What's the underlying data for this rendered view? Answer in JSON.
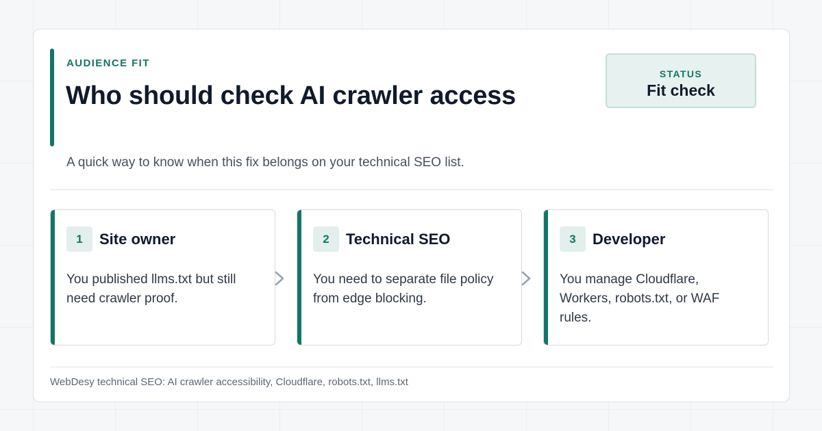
{
  "header": {
    "eyebrow": "AUDIENCE FIT",
    "title": "Who should check AI crawler access",
    "subtitle": "A quick way to know when this fix belongs on your technical SEO list."
  },
  "status": {
    "label": "STATUS",
    "value": "Fit check"
  },
  "steps": [
    {
      "number": "1",
      "title": "Site owner",
      "description": "You published llms.txt but still need crawler proof."
    },
    {
      "number": "2",
      "title": "Technical SEO",
      "description": "You need to separate file policy from edge blocking."
    },
    {
      "number": "3",
      "title": "Developer",
      "description": "You manage Cloudflare, Workers, robots.txt, or WAF rules."
    }
  ],
  "footer": {
    "text": "WebDesy technical SEO: AI crawler accessibility, Cloudflare, robots.txt, llms.txt"
  },
  "colors": {
    "accent": "#137565",
    "title_text": "#111a2b",
    "status_background": "#e7f1ef",
    "chevron": "#9aa3b2"
  },
  "icons": {
    "step_connector": "chevron-right-icon"
  }
}
